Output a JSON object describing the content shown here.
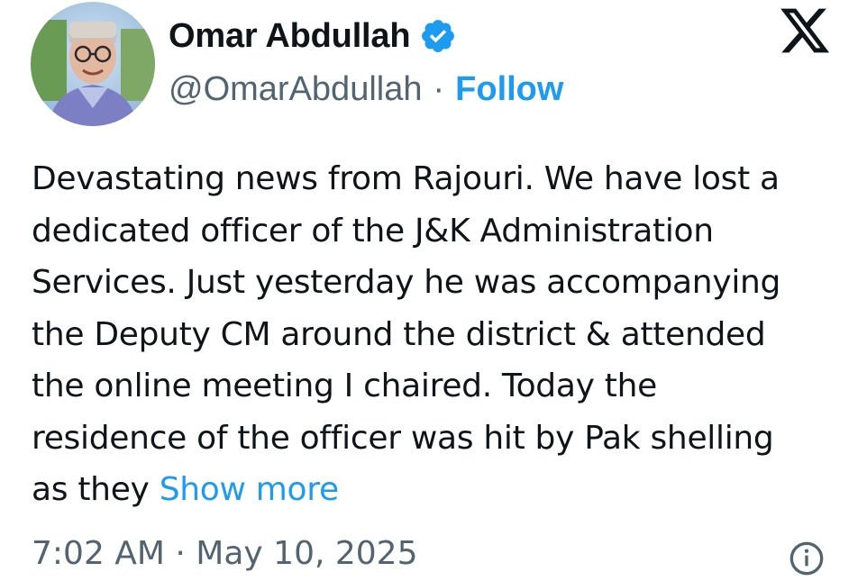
{
  "author": {
    "display_name": "Omar Abdullah",
    "handle": "@OmarAbdullah",
    "separator": "·",
    "follow_label": "Follow",
    "verified": true
  },
  "brand": {
    "logo": "x-logo-icon",
    "accent_color": "#1d9bf0",
    "text_color": "#0f1419",
    "muted_color": "#536471"
  },
  "tweet": {
    "lines": [
      "Devastating news from Rajouri. We have lost a",
      "dedicated officer of the J&K Administration",
      "Services. Just yesterday he was accompanying",
      "the Deputy CM around the district & attended",
      "the online meeting I chaired. Today the",
      "residence of the officer was hit by Pak shelling",
      "as they"
    ],
    "show_more_label": "Show more"
  },
  "meta": {
    "timestamp": "7:02 AM · May 10, 2025",
    "info_icon": "info-icon"
  }
}
